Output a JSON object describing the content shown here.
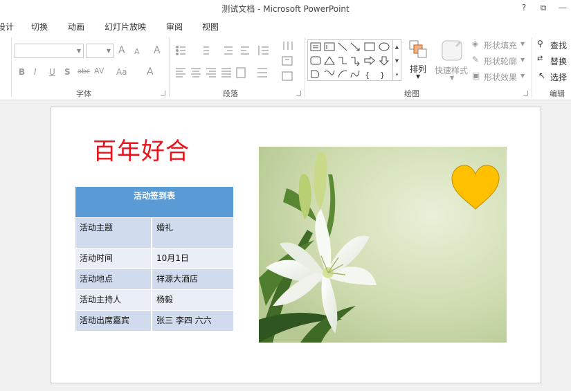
{
  "window": {
    "title": "测试文档 - Microsoft PowerPoint",
    "help": "?",
    "restore": "⧉",
    "minimize": "—"
  },
  "tabs": [
    "设计",
    "切换",
    "动画",
    "幻灯片放映",
    "审阅",
    "视图"
  ],
  "ribbon": {
    "font_group": {
      "label": "字体",
      "font_name": "",
      "font_size": "",
      "grow": "A",
      "shrink": "A",
      "clear": "A",
      "bold": "B",
      "italic": "I",
      "underline": "U",
      "shadow": "S",
      "strike": "abc",
      "spacing": "AV",
      "case": "Aa",
      "color": "A"
    },
    "paragraph_group": {
      "label": "段落"
    },
    "drawing_group": {
      "label": "绘图",
      "arrange": "排列",
      "quick_styles": "快速样式",
      "shape_fill": "形状填充",
      "shape_outline": "形状轮廓",
      "shape_effects": "形状效果"
    },
    "editing_group": {
      "label": "编辑",
      "find": "查找",
      "replace": "替换",
      "select": "选择"
    }
  },
  "slide": {
    "title": "百年好合",
    "table": {
      "header": "活动签到表",
      "rows": [
        [
          "活动主题",
          "婚礼"
        ],
        [
          "活动时间",
          "10月1日"
        ],
        [
          "活动地点",
          "祥源大酒店"
        ],
        [
          "活动主持人",
          "杨毅"
        ],
        [
          "活动出席嘉宾",
          "张三  李四   六六"
        ]
      ]
    },
    "colors": {
      "title": "#e8141b",
      "table_header": "#5b9bd5",
      "heart": "#ffc000"
    }
  }
}
